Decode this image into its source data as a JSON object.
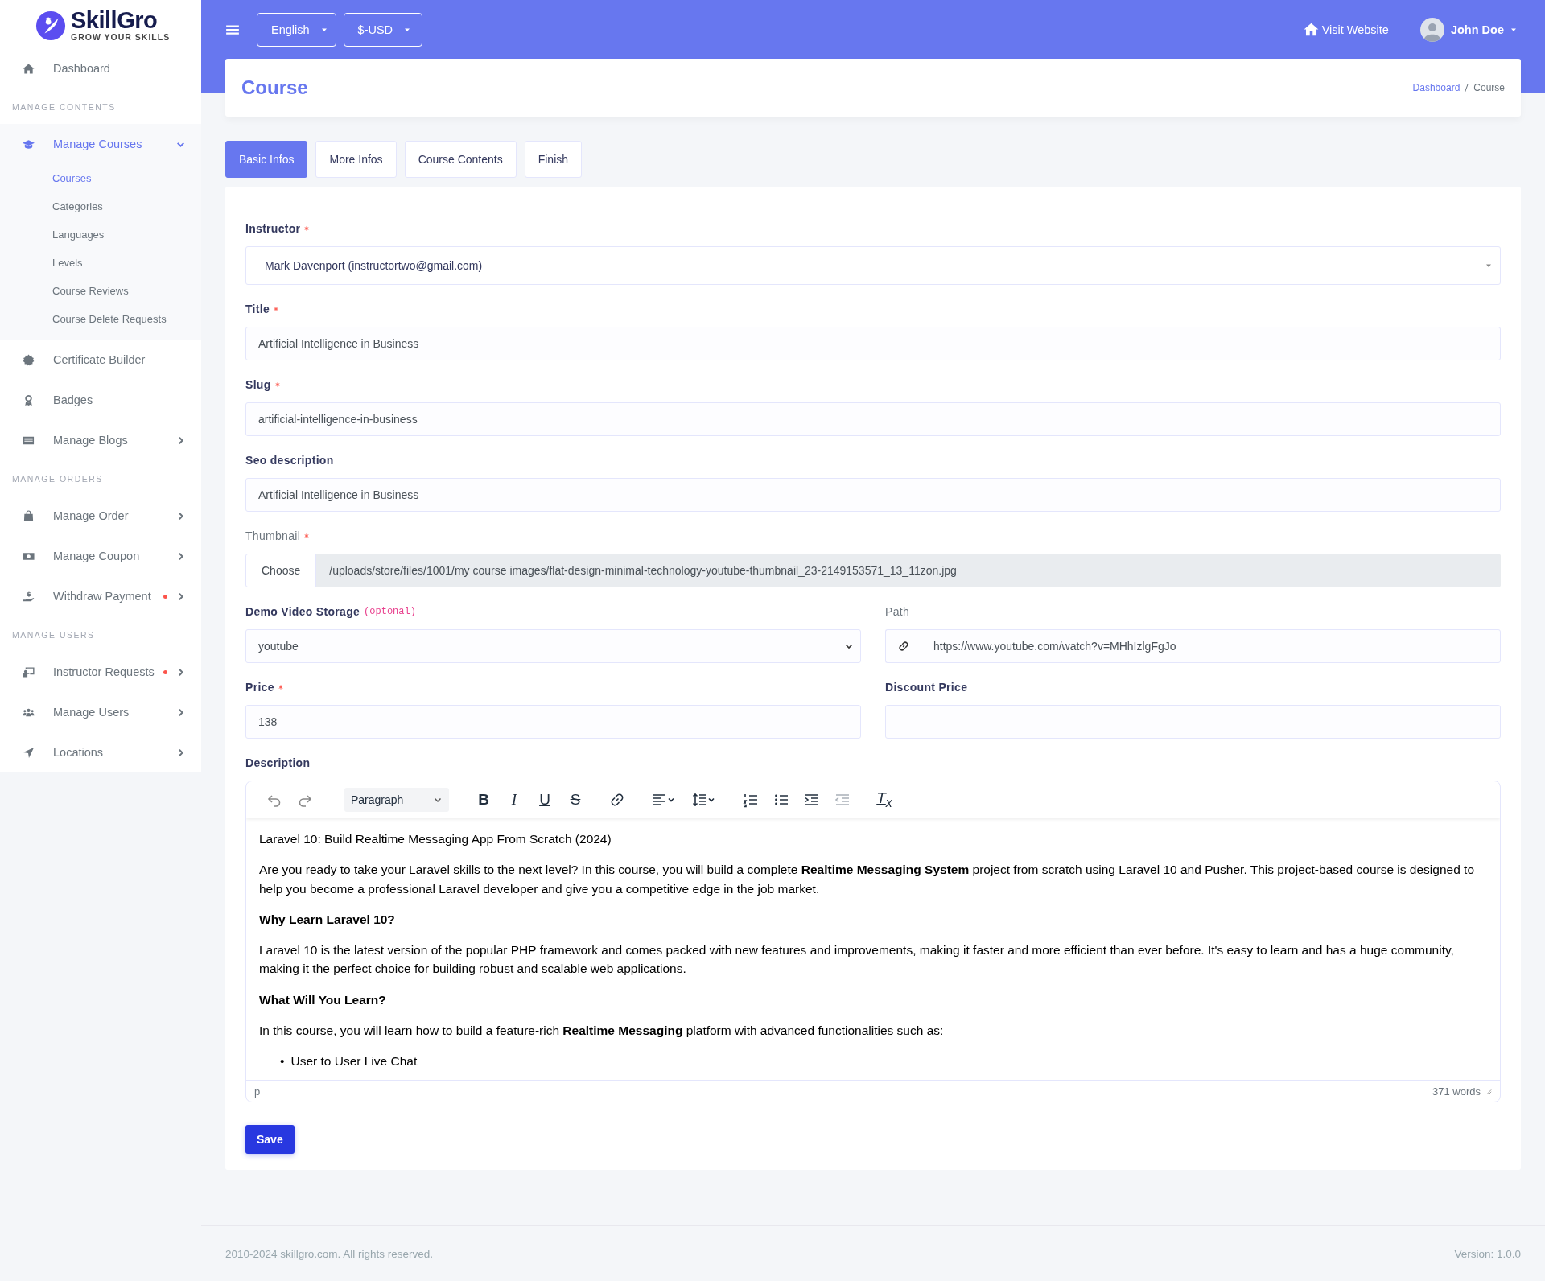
{
  "brand": {
    "name": "SkillGro",
    "tagline": "GROW YOUR SKILLS"
  },
  "sidebar": {
    "items": [
      {
        "kind": "link",
        "label": "Dashboard",
        "selected": false,
        "dot": false
      },
      {
        "kind": "heading",
        "label": "MANAGE CONTENTS"
      },
      {
        "kind": "link",
        "label": "Manage Courses",
        "selected": true,
        "dot": false,
        "expanded": true,
        "children": [
          {
            "label": "Courses",
            "selected": true
          },
          {
            "label": "Categories",
            "selected": false
          },
          {
            "label": "Languages",
            "selected": false
          },
          {
            "label": "Levels",
            "selected": false
          },
          {
            "label": "Course Reviews",
            "selected": false
          },
          {
            "label": "Course Delete Requests",
            "selected": false
          }
        ]
      },
      {
        "kind": "link",
        "label": "Certificate Builder",
        "selected": false,
        "dot": false
      },
      {
        "kind": "link",
        "label": "Badges",
        "selected": false,
        "dot": false
      },
      {
        "kind": "link",
        "label": "Manage Blogs",
        "selected": false,
        "dot": false,
        "expanded": false
      },
      {
        "kind": "heading",
        "label": "MANAGE ORDERS"
      },
      {
        "kind": "link",
        "label": "Manage Order",
        "selected": false,
        "dot": false,
        "expanded": false
      },
      {
        "kind": "link",
        "label": "Manage Coupon",
        "selected": false,
        "dot": false,
        "expanded": false
      },
      {
        "kind": "link",
        "label": "Withdraw Payment",
        "selected": false,
        "dot": true,
        "expanded": false
      },
      {
        "kind": "heading",
        "label": "MANAGE USERS"
      },
      {
        "kind": "link",
        "label": "Instructor Requests",
        "selected": false,
        "dot": true,
        "expanded": false
      },
      {
        "kind": "link",
        "label": "Manage Users",
        "selected": false,
        "dot": false,
        "expanded": false
      },
      {
        "kind": "link",
        "label": "Locations",
        "selected": false,
        "dot": false,
        "expanded": false
      }
    ]
  },
  "topbar": {
    "language": "English",
    "currency": "$-USD",
    "visit_website": "Visit Website",
    "user": "John Doe"
  },
  "header": {
    "title": "Course",
    "breadcrumbs": [
      "Dashboard",
      "Course"
    ]
  },
  "tabs": [
    {
      "label": "Basic Infos",
      "selected": true
    },
    {
      "label": "More Infos",
      "selected": false
    },
    {
      "label": "Course Contents",
      "selected": false
    },
    {
      "label": "Finish",
      "selected": false
    }
  ],
  "form": {
    "instructor": {
      "label": "Instructor",
      "required": true,
      "value": "Mark Davenport (instructortwo@gmail.com)"
    },
    "title": {
      "label": "Title",
      "required": true,
      "value": "Artificial Intelligence in Business"
    },
    "slug": {
      "label": "Slug",
      "required": true,
      "value": "artificial-intelligence-in-business"
    },
    "seo_description": {
      "label": "Seo description",
      "required": false,
      "value": "Artificial Intelligence in Business"
    },
    "thumbnail": {
      "label": "Thumbnail",
      "required": true,
      "button": "Choose",
      "value": "/uploads/store/files/1001/my course images/flat-design-minimal-technology-youtube-thumbnail_23-2149153571_13_11zon.jpg"
    },
    "demo_video_storage": {
      "label": "Demo Video Storage",
      "required": false,
      "note": "(optonal)",
      "value": "youtube"
    },
    "path": {
      "label": "Path",
      "required": false,
      "value": "https://www.youtube.com/watch?v=MHhIzlgFgJo"
    },
    "price": {
      "label": "Price",
      "required": true,
      "value": "138"
    },
    "discount_price": {
      "label": "Discount Price",
      "required": false
    },
    "description": {
      "label": "Description",
      "toolbar": {
        "block_format": "Paragraph",
        "format_buttons": [
          "B",
          "I",
          "U",
          "S"
        ],
        "clear_format": "T$_{x}$",
        "outdent_disabled": true
      },
      "content": [
        {
          "kind": "paragraph",
          "text": "Laravel 10: Build Realtime Messaging App From Scratch (2024)"
        },
        {
          "kind": "paragraph",
          "text": "Are you ready to take your Laravel skills to the next level? In this course, you will build a complete **Realtime Messaging System** project from scratch using Laravel 10 and Pusher. This project-based course is designed to help you become a professional Laravel developer and give you a competitive edge in the job market."
        },
        {
          "kind": "heading",
          "text": "Why Learn Laravel 10?"
        },
        {
          "kind": "paragraph",
          "text": "Laravel 10 is the latest version of the popular PHP framework and comes packed with new features and improvements, making it faster and more efficient than ever before. It's easy to learn and has a huge community, making it the perfect choice for building robust and scalable web applications."
        },
        {
          "kind": "heading",
          "text": "What Will You Learn?"
        },
        {
          "kind": "paragraph",
          "text": "In this course, you will learn how to build a feature-rich **Realtime Messaging** platform with advanced functionalities such as:"
        },
        {
          "kind": "list",
          "items": [
            {
              "marker": "•",
              "text": "User to User Live Chat"
            }
          ]
        }
      ],
      "element_path": "p",
      "word_count": "371 words"
    },
    "save": "Save"
  },
  "footer": {
    "copyright": "2010-2024 skillgro.com. All rights reserved.",
    "version": "Version: 1.0.0"
  }
}
